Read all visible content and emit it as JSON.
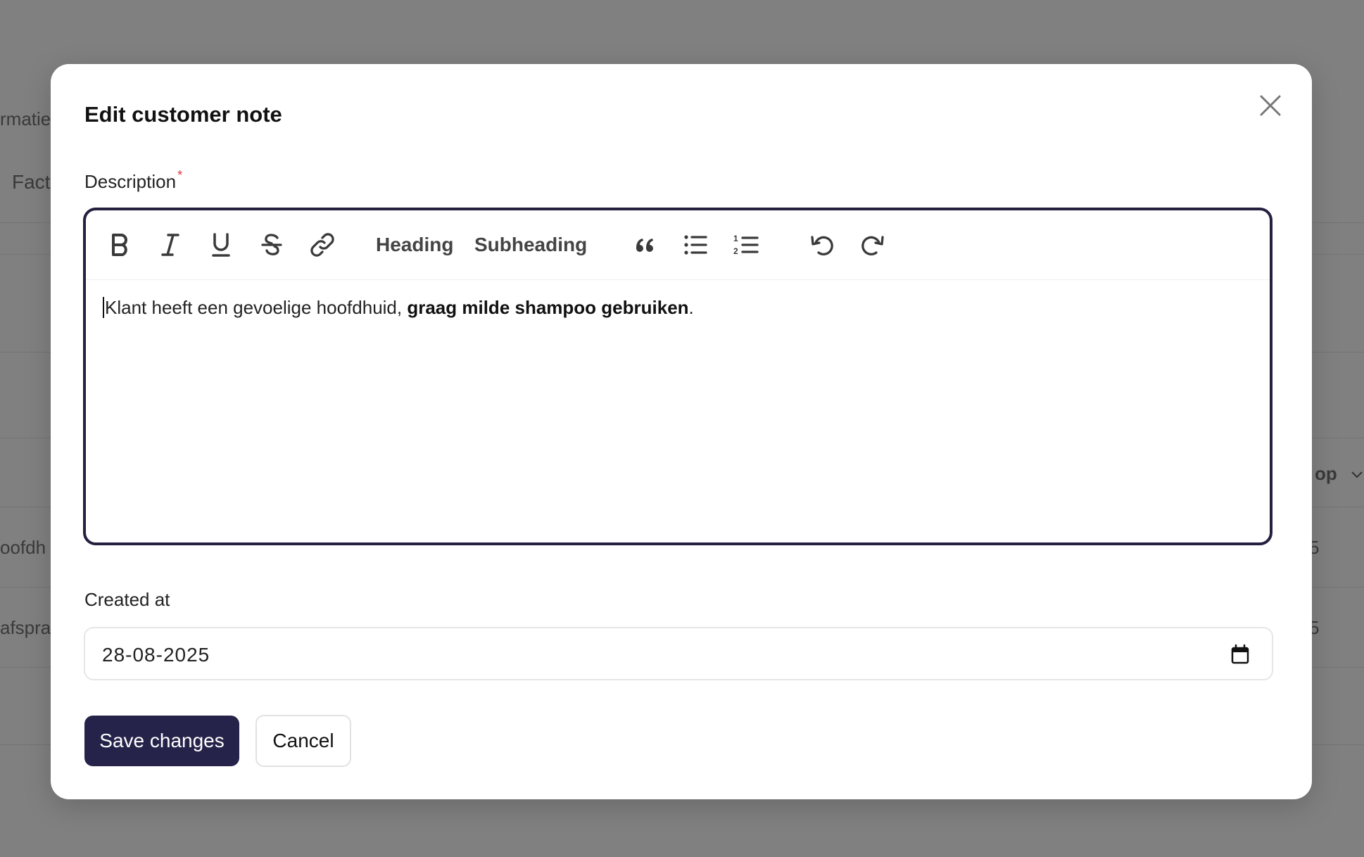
{
  "background": {
    "fragments": [
      "rmatie",
      "Fact",
      "oofdh",
      "afspra",
      "op",
      "5",
      "5"
    ]
  },
  "modal": {
    "title": "Edit customer note",
    "close_icon": "close-icon"
  },
  "description": {
    "label": "Description",
    "required_marker": "*",
    "toolbar": {
      "heading_label": "Heading",
      "subheading_label": "Subheading",
      "icons": [
        "bold-icon",
        "italic-icon",
        "underline-icon",
        "strikethrough-icon",
        "link-icon",
        "quote-icon",
        "bullet-list-icon",
        "numbered-list-icon",
        "undo-icon",
        "redo-icon"
      ]
    },
    "content": {
      "plain": "Klant heeft een gevoelige hoofdhuid, ",
      "bold": "graag milde shampoo gebruiken",
      "trailing": "."
    }
  },
  "created_at": {
    "label": "Created at",
    "value": "28-08-2025",
    "icon": "calendar-icon"
  },
  "actions": {
    "save_label": "Save changes",
    "cancel_label": "Cancel"
  },
  "colors": {
    "primary": "#252349",
    "editor_border": "#24203f",
    "required": "#e0323c",
    "overlay": "#808080"
  }
}
